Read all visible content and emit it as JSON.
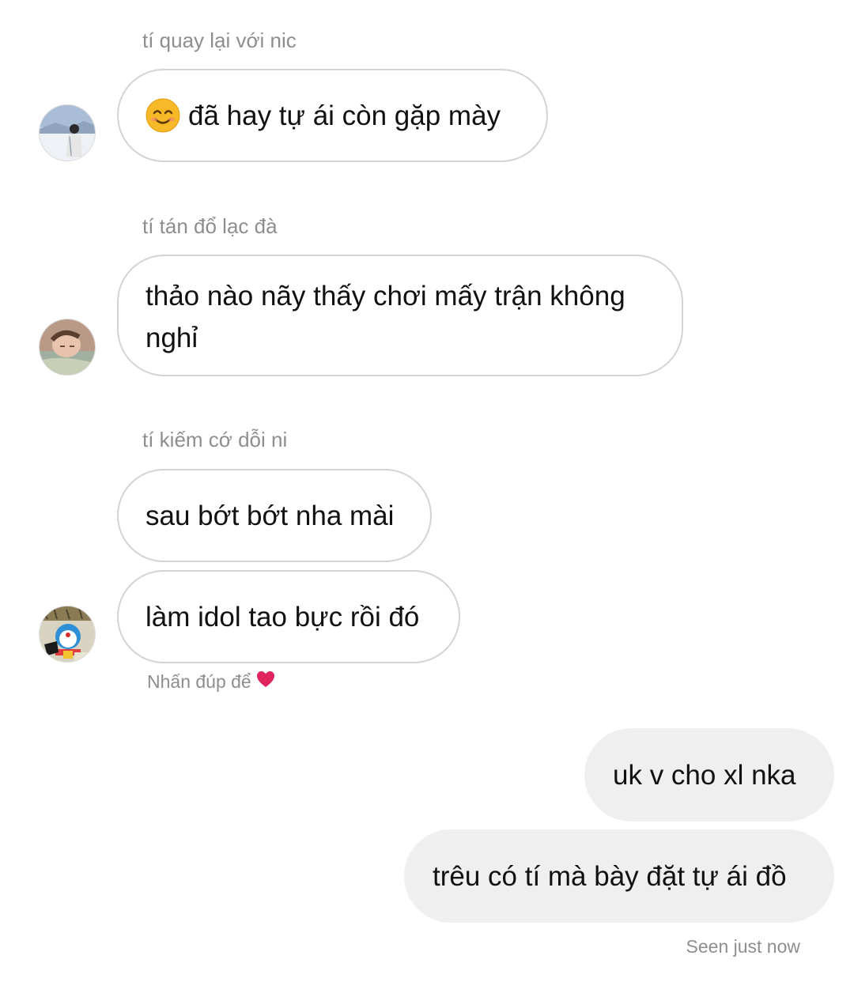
{
  "messages_in": [
    {
      "sender": "tí quay lại với nic",
      "bubbles": [
        {
          "text": "đã hay tự ái còn gặp mày",
          "emoji": "smiling-face-icon"
        }
      ]
    },
    {
      "sender": "tí tán đổ lạc đà",
      "bubbles": [
        {
          "text": "thảo nào nãy thấy chơi mấy trận không nghỉ"
        }
      ]
    },
    {
      "sender": "tí kiếm cớ dỗi ni",
      "bubbles": [
        {
          "text": "sau bớt bớt nha mài"
        },
        {
          "text": "làm idol tao bực rồi đó"
        }
      ]
    }
  ],
  "double_tap_hint": "Nhấn đúp để",
  "double_tap_icon": "heart-icon",
  "messages_out": [
    {
      "text": "uk v cho xl nka"
    },
    {
      "text": "trêu có tí mà bày đặt tự ái đồ"
    }
  ],
  "seen_status": "Seen just now",
  "colors": {
    "incoming_border": "#d4d4d4",
    "outgoing_bg": "#efefef",
    "meta_text": "#8e8e8e",
    "heart": "#e0245e"
  }
}
